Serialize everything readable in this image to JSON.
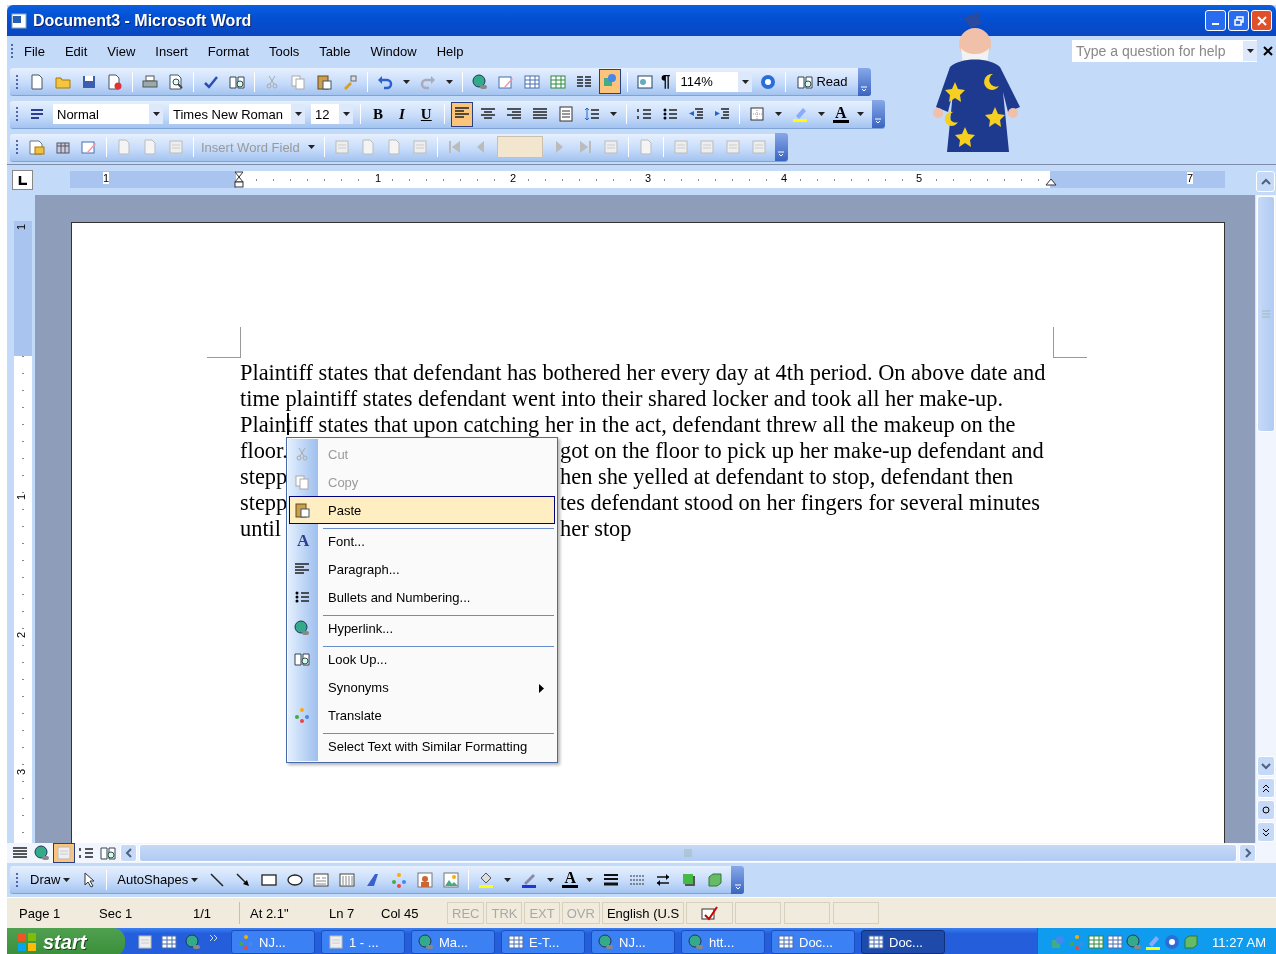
{
  "window": {
    "title": "Document3 - Microsoft Word"
  },
  "menu_bar": [
    "File",
    "Edit",
    "View",
    "Insert",
    "Format",
    "Tools",
    "Table",
    "Window",
    "Help"
  ],
  "help_box": {
    "placeholder": "Type a question for help"
  },
  "standard_toolbar": {
    "drawing_on": true,
    "show_marks": "¶",
    "zoom": "114%",
    "read": "Read"
  },
  "formatting_toolbar": {
    "style": "Normal",
    "font": "Times New Roman",
    "size": "12",
    "bold": "B",
    "italic": "I",
    "underline": "U",
    "alignments": [
      {
        "selected": true
      },
      {
        "selected": false
      },
      {
        "selected": false
      },
      {
        "selected": false
      }
    ],
    "font_color": "A"
  },
  "mail_merge_toolbar": {
    "insert_word_field": "Insert Word Field",
    "disabled": true
  },
  "ruler": {
    "labels": [
      "1",
      "1",
      "2",
      "3",
      "4",
      "5",
      "7"
    ]
  },
  "vertical_ruler": {
    "labels": [
      "1",
      "1",
      "2",
      "3"
    ]
  },
  "document": {
    "lines": [
      {
        "kind": "full",
        "text": "Plaintiff states that defendant has bothered her every day at 4th period. On above date and"
      },
      {
        "kind": "full",
        "text": "time plaintiff states defendant went into their shared locker and took all her make-up."
      },
      {
        "kind": "full",
        "text": "Plaintiff states that upon catching her in the act, defendant threw all the makeup on the"
      },
      {
        "kind": "split",
        "left": "floor.",
        "right": "got on the floor to pick up her make-up defendant and"
      },
      {
        "kind": "split",
        "left": "stepp",
        "right": "hen she yelled at defendant to stop, defendant then"
      },
      {
        "kind": "split",
        "left": "stepp",
        "right": "tes defendant stood on her fingers for several minutes"
      },
      {
        "kind": "split",
        "left": "until",
        "right": "her stop"
      }
    ]
  },
  "context_menu": {
    "items": [
      {
        "label": "Cut",
        "disabled": true,
        "selected": false,
        "submenu": false,
        "separator_before": false
      },
      {
        "label": "Copy",
        "disabled": true,
        "selected": false,
        "submenu": false,
        "separator_before": false
      },
      {
        "label": "Paste",
        "disabled": false,
        "selected": true,
        "submenu": false,
        "separator_before": false
      },
      {
        "label": "Font...",
        "glyph": "A",
        "disabled": false,
        "selected": false,
        "submenu": false,
        "separator_before": true
      },
      {
        "label": "Paragraph...",
        "disabled": false,
        "selected": false,
        "submenu": false,
        "separator_before": false
      },
      {
        "label": "Bullets and Numbering...",
        "disabled": false,
        "selected": false,
        "submenu": false,
        "separator_before": false
      },
      {
        "label": "Hyperlink...",
        "disabled": false,
        "selected": false,
        "submenu": false,
        "separator_before": true
      },
      {
        "label": "Look Up...",
        "disabled": false,
        "selected": false,
        "submenu": false,
        "separator_before": true
      },
      {
        "label": "Synonyms",
        "disabled": false,
        "selected": false,
        "submenu": true,
        "separator_before": false
      },
      {
        "label": "Translate",
        "disabled": false,
        "selected": false,
        "submenu": false,
        "separator_before": false
      },
      {
        "label": "Select Text with Similar Formatting",
        "disabled": false,
        "selected": false,
        "submenu": false,
        "separator_before": true
      }
    ]
  },
  "view_buttons": [
    {
      "selected": false
    },
    {
      "selected": false
    },
    {
      "selected": true
    },
    {
      "selected": false
    },
    {
      "selected": false
    }
  ],
  "drawing_toolbar": {
    "draw": "Draw",
    "autoshapes": "AutoShapes",
    "font_color": "A"
  },
  "status_bar": {
    "fields": [
      "Page 1",
      "Sec 1",
      "1/1",
      "At 2.1\"",
      "Ln 7",
      "Col 45"
    ],
    "modes": [
      {
        "label": "REC",
        "on": false
      },
      {
        "label": "TRK",
        "on": false
      },
      {
        "label": "EXT",
        "on": false
      },
      {
        "label": "OVR",
        "on": false
      }
    ],
    "language": "English (U.S"
  },
  "taskbar": {
    "start": "start",
    "buttons": [
      {
        "label": "NJ...",
        "selected": false
      },
      {
        "label": "1 - ...",
        "selected": false
      },
      {
        "label": "Ma...",
        "selected": false
      },
      {
        "label": "E-T...",
        "selected": false
      },
      {
        "label": "NJ...",
        "selected": false
      },
      {
        "label": "htt...",
        "selected": false
      },
      {
        "label": "Doc...",
        "selected": false
      },
      {
        "label": "Doc...",
        "selected": true
      }
    ],
    "clock": "11:27 AM"
  }
}
